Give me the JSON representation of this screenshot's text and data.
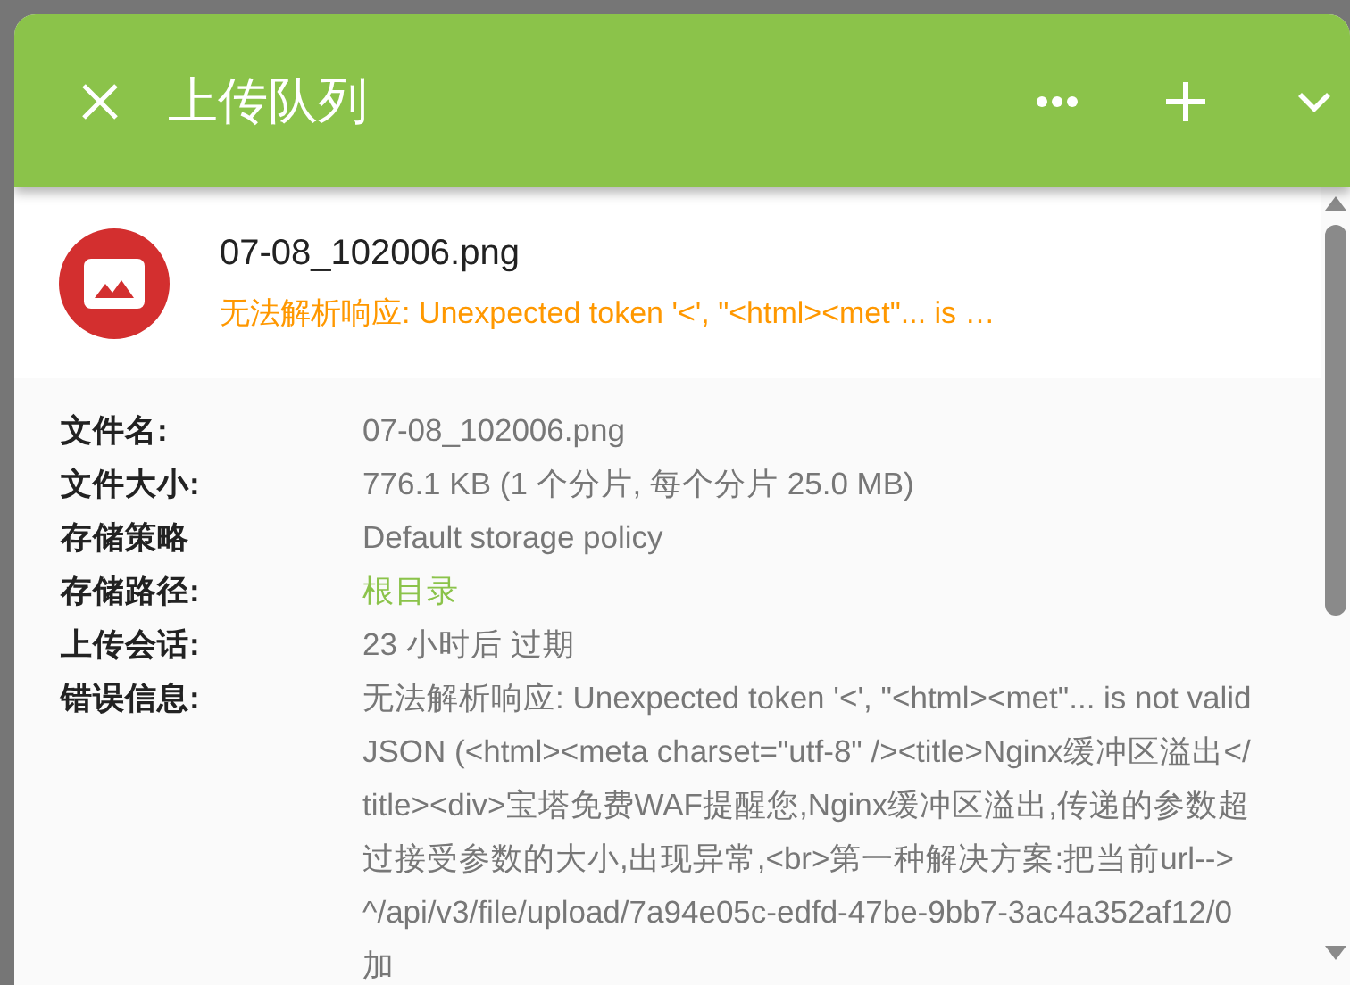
{
  "header": {
    "title": "上传队列"
  },
  "item": {
    "filename": "07-08_102006.png",
    "error": "无法解析响应: Unexpected token '<', \"<html><met\"... is …"
  },
  "details": [
    {
      "label": "文件名:",
      "value": "07-08_102006.png",
      "kind": "text"
    },
    {
      "label": "文件大小:",
      "value": "776.1 KB (1 个分片, 每个分片 25.0 MB)",
      "kind": "text"
    },
    {
      "label": "存储策略",
      "value": "Default storage policy",
      "kind": "text"
    },
    {
      "label": "存储路径:",
      "value": "根目录",
      "kind": "link"
    },
    {
      "label": "上传会话:",
      "value": "23 小时后 过期",
      "kind": "text"
    },
    {
      "label": "错误信息:",
      "value": "无法解析响应: Unexpected token '<', \"<html><met\"... is not valid JSON (<html><meta charset=\"utf-8\" /><title>Nginx缓冲区溢出</title><div>宝塔免费WAF提醒您,Nginx缓冲区溢出,传递的参数超过接受参数的大小,出现异常,<br>第一种解决方案:把当前url-->^/api/v3/file/upload/7a94e05c-edfd-47be-9bb7-3ac4a352af12/0加",
      "kind": "text"
    }
  ]
}
